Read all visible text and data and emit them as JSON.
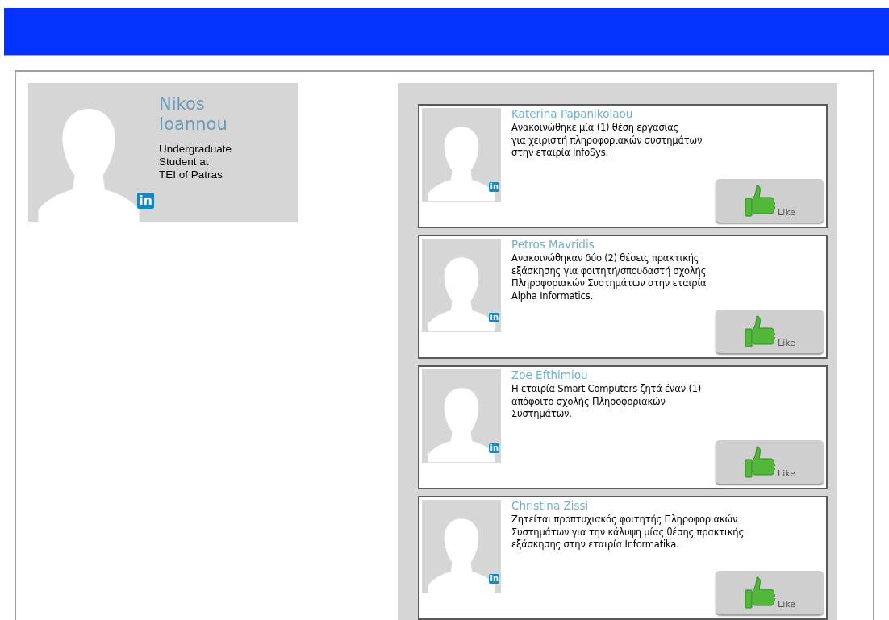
{
  "profile": {
    "first_name": "Nikos",
    "last_name": "Ioannou",
    "headline": "Undergraduate\nStudent at\nTEI of Patras",
    "badge": "in"
  },
  "feed": [
    {
      "author": "Katerina Papanikolaou",
      "text": "Ανακοινώθηκε μία (1) θέση εργασίας\nγια χειριστή πληροφοριακών συστημάτων\nστην εταιρία InfoSys.",
      "badge": "in",
      "like": "Like"
    },
    {
      "author": "Petros Mavridis",
      "text": "Ανακοινώθηκαν δύο (2) θέσεις πρακτικής\nεξάσκησης για φοιτητή/σπουδαστή σχολής\nΠληροφοριακών Συστημάτων στην εταιρία\nAlpha Informatics.",
      "badge": "in",
      "like": "Like"
    },
    {
      "author": "Zoe Efthimiou",
      "text": "Η εταιρία Smart Computers ζητά έναν (1)\nαπόφοιτο σχολής Πληροφοριακών\nΣυστημάτων.",
      "badge": "in",
      "like": "Like"
    },
    {
      "author": "Christina Zissi",
      "text": "Ζητείται προπτυχιακός φοιτητής Πληροφοριακών\nΣυστημάτων για την κάλυψη μίας θέσης πρακτικής\nεξάσκησης στην εταιρία Informatika.",
      "badge": "in",
      "like": "Like"
    }
  ]
}
